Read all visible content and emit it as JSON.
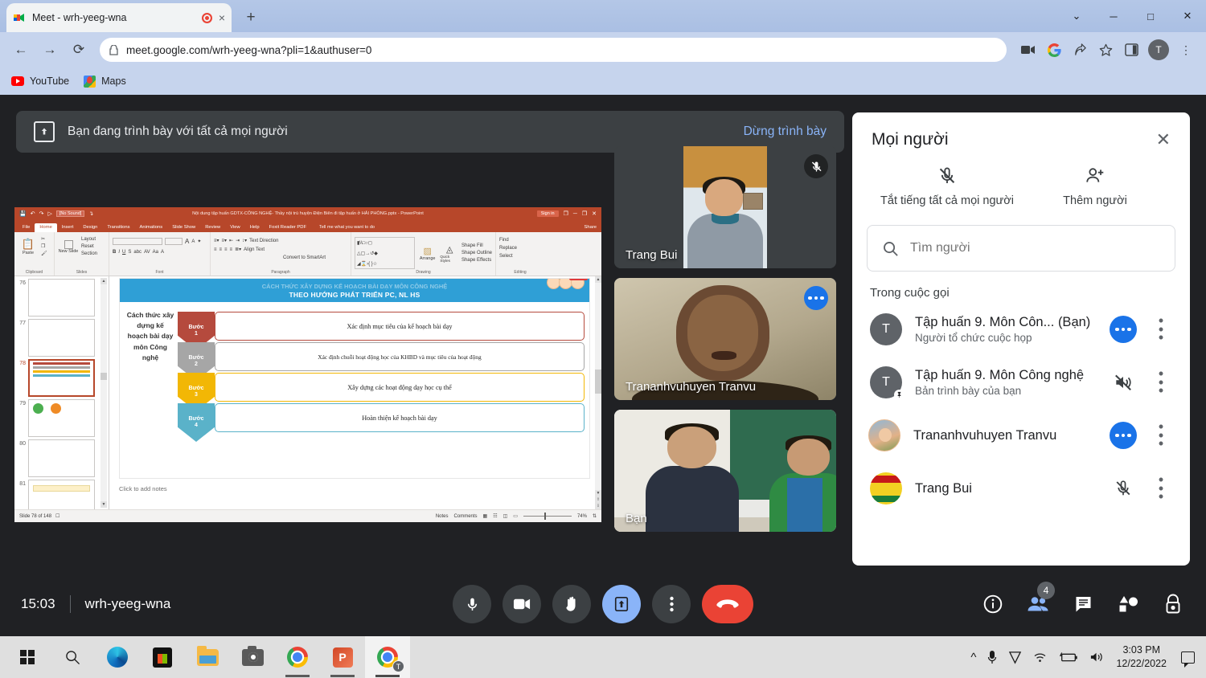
{
  "browser": {
    "tab": {
      "title": "Meet - wrh-yeeg-wna",
      "favicon": "meet-icon",
      "recording_indicator": "record-dot",
      "close": "×"
    },
    "new_tab": "+",
    "window_controls": {
      "minimize": "─",
      "maximize": "□",
      "close": "✕",
      "expand": "⌄"
    },
    "nav": {
      "back": "←",
      "forward": "→",
      "reload": "⟳"
    },
    "url": "meet.google.com/wrh-yeeg-wna?pli=1&authuser=0",
    "lock": "🔒",
    "omnibox_icons": [
      "video-camera-icon",
      "google-g-icon",
      "share-icon",
      "bookmark-star-icon",
      "side-panel-icon"
    ],
    "profile_initial": "T",
    "menu": "⋮",
    "bookmarks": [
      {
        "label": "YouTube",
        "icon": "youtube-icon"
      },
      {
        "label": "Maps",
        "icon": "google-maps-icon"
      }
    ]
  },
  "meet": {
    "banner": {
      "icon": "present-screen-icon",
      "text": "Bạn đang trình bày với tất cả mọi người",
      "stop_label": "Dừng trình bày"
    },
    "tiles": [
      {
        "name": "Trang Bui",
        "badge": "mic-off-icon",
        "active": false
      },
      {
        "name": "Trananhvuhuyen Tranvu",
        "badge": "speaking-dots-icon",
        "active": true
      },
      {
        "name": "Bạn",
        "badge": "",
        "active": false
      }
    ],
    "bottom_bar": {
      "time": "15:03",
      "meeting_code": "wrh-yeeg-wna",
      "center_buttons": [
        {
          "name": "microphone",
          "icon": "mic-icon",
          "state": "on"
        },
        {
          "name": "camera",
          "icon": "video-camera-icon",
          "state": "on"
        },
        {
          "name": "raise-hand",
          "icon": "hand-icon",
          "state": "on"
        },
        {
          "name": "present-now",
          "icon": "present-screen-icon",
          "state": "active"
        },
        {
          "name": "more-options",
          "icon": "more-vertical-icon",
          "state": "on"
        },
        {
          "name": "leave-call",
          "icon": "end-call-icon",
          "state": "danger"
        }
      ],
      "right_buttons": [
        {
          "name": "meeting-details",
          "icon": "info-icon",
          "badge": ""
        },
        {
          "name": "show-everyone",
          "icon": "people-icon",
          "badge": "4"
        },
        {
          "name": "chat-with-everyone",
          "icon": "chat-icon",
          "badge": ""
        },
        {
          "name": "activities",
          "icon": "activities-icon",
          "badge": ""
        },
        {
          "name": "host-controls",
          "icon": "lock-shield-icon",
          "badge": ""
        }
      ]
    },
    "people_panel": {
      "title": "Mọi người",
      "close_icon": "close-icon",
      "actions": [
        {
          "label": "Tắt tiếng tất cả mọi người",
          "icon": "mic-off-icon"
        },
        {
          "label": "Thêm người",
          "icon": "add-person-icon"
        }
      ],
      "search_placeholder": "Tìm người",
      "search_value": "",
      "section_label": "Trong cuộc gọi",
      "participants": [
        {
          "name": "Tập huấn 9. Môn Côn...  (Bạn)",
          "sub": "Người tổ chức cuộc họp",
          "avatar_initial": "T",
          "avatar_type": "initial",
          "status": "speaking-dots-icon",
          "pinned": false
        },
        {
          "name": "Tập huấn 9. Môn Công nghệ",
          "sub": "Bản trình bày của bạn",
          "avatar_initial": "T",
          "avatar_type": "initial",
          "status": "speaker-off-icon",
          "pinned": true
        },
        {
          "name": "Trananhvuhuyen Tranvu",
          "sub": "",
          "avatar_initial": "",
          "avatar_type": "photo-kid",
          "status": "speaking-dots-icon",
          "pinned": false
        },
        {
          "name": "Trang Bui",
          "sub": "",
          "avatar_initial": "",
          "avatar_type": "photo-honey",
          "status": "mic-off-icon",
          "pinned": false
        }
      ],
      "row_menu_icon": "more-vertical-icon"
    }
  },
  "powerpoint": {
    "title": "Nội dung tập huấn GDTX-CÔNG NGHỆ- Thầy nội trú huyện Điện Biên đi tập huấn ở HẢI PHÒNG.pptx  -  PowerPoint",
    "quick_access": {
      "save": "save-icon",
      "undo": "undo-icon",
      "redo": "redo-icon",
      "sound_dropdown": "[No Sound]",
      "start_slideshow": "slideshow-icon"
    },
    "sign_in": "Sign in",
    "window_buttons": {
      "ribbon_display": "❐",
      "minimize": "─",
      "restore": "❐",
      "close": "✕"
    },
    "tabs": [
      "File",
      "Home",
      "Insert",
      "Design",
      "Transitions",
      "Animations",
      "Slide Show",
      "Review",
      "View",
      "Help",
      "Foxit Reader PDF"
    ],
    "active_tab": "Home",
    "tell_me": "Tell me what you want to do",
    "share": "Share",
    "ribbon_groups": [
      {
        "name": "Clipboard",
        "items": [
          "Paste",
          "Cut",
          "Copy",
          "Format Painter"
        ]
      },
      {
        "name": "Slides",
        "items": [
          "New Slide",
          "Layout",
          "Reset",
          "Section"
        ]
      },
      {
        "name": "Font",
        "items": [
          "B",
          "I",
          "U",
          "S",
          "AV",
          "Aa",
          "A"
        ]
      },
      {
        "name": "Paragraph",
        "items": [
          "Text Direction",
          "Align Text",
          "Convert to SmartArt"
        ]
      },
      {
        "name": "Drawing",
        "items": [
          "Arrange",
          "Quick Styles",
          "Shape Fill",
          "Shape Outline",
          "Shape Effects"
        ]
      },
      {
        "name": "Editing",
        "items": [
          "Find",
          "Replace",
          "Select"
        ]
      }
    ],
    "thumbnails": [
      {
        "number": "76",
        "selected": false
      },
      {
        "number": "77",
        "selected": false
      },
      {
        "number": "78",
        "selected": true
      },
      {
        "number": "79",
        "selected": false
      },
      {
        "number": "80",
        "selected": false
      },
      {
        "number": "81",
        "selected": false
      }
    ],
    "slide": {
      "header_line1": "CÁCH THỨC XÂY DỰNG KẾ HOẠCH BÀI DẠY MÔN CÔNG NGHỆ",
      "header_line2": "THEO HƯỚNG PHÁT TRIỂN PC, NL HS",
      "left_label": "Cách thức xây dựng kế hoạch bài dạy môn Công nghệ",
      "steps": [
        {
          "step_label": "Bước",
          "step_number": "1",
          "text": "Xác định mục tiêu của kế hoạch bài dạy",
          "color": "#b54a3d"
        },
        {
          "step_label": "Bước",
          "step_number": "2",
          "text": "Xác định chuỗi hoạt động học của KHBD và mục tiêu của hoạt động",
          "color": "#a6a6a6"
        },
        {
          "step_label": "Bước",
          "step_number": "3",
          "text": "Xây dựng các hoạt động dạy học cụ thể",
          "color": "#f2b705"
        },
        {
          "step_label": "Bước",
          "step_number": "4",
          "text": "Hoàn thiện kế hoạch bài dạy",
          "color": "#5ab2c9"
        }
      ],
      "notes_placeholder": "Click to add notes"
    },
    "status_bar": {
      "slide_counter": "Slide 78 of 148",
      "notes": "Notes",
      "comments": "Comments",
      "views": [
        "normal-view-icon",
        "slide-sorter-icon",
        "reading-view-icon",
        "slideshow-icon"
      ],
      "zoom": "74%",
      "fit_icon": "fit-slide-icon"
    }
  },
  "taskbar": {
    "items": [
      {
        "name": "start-button",
        "icon": "windows-logo-icon"
      },
      {
        "name": "search",
        "icon": "search-icon"
      },
      {
        "name": "microsoft-edge",
        "icon": "edge-icon"
      },
      {
        "name": "microsoft-store",
        "icon": "store-icon"
      },
      {
        "name": "file-explorer",
        "icon": "folder-icon"
      },
      {
        "name": "camera",
        "icon": "camera-icon"
      },
      {
        "name": "google-chrome",
        "icon": "chrome-icon"
      },
      {
        "name": "powerpoint",
        "icon": "powerpoint-icon"
      },
      {
        "name": "google-chrome-meet",
        "icon": "chrome-icon"
      }
    ],
    "tray": {
      "chevron": "^",
      "icons": [
        "microphone-icon",
        "v-app-icon",
        "wifi-icon",
        "battery-icon",
        "volume-icon"
      ],
      "time": "3:03 PM",
      "date": "12/22/2022",
      "notifications": "notification-icon"
    }
  }
}
